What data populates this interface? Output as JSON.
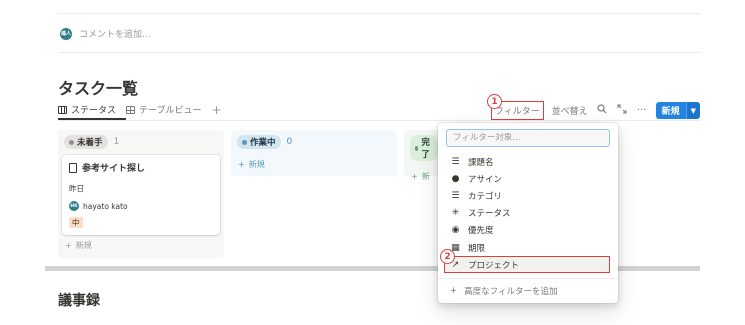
{
  "comment": {
    "avatar": "鳩人",
    "placeholder": "コメントを追加..."
  },
  "page": {
    "title": "タスク一覧",
    "section_title": "議事録"
  },
  "tabs": [
    {
      "label": "ステータス",
      "active": true,
      "icon": "board-icon"
    },
    {
      "label": "テーブルビュー",
      "active": false,
      "icon": "table-icon"
    }
  ],
  "toolbar": {
    "filter_label": "フィルター",
    "sort_label": "並べ替え",
    "new_label": "新規"
  },
  "annotations": {
    "badge1": "1",
    "badge2": "2"
  },
  "board": {
    "columns": [
      {
        "label": "未着手",
        "count": "1",
        "add_label": "新規"
      },
      {
        "label": "作業中",
        "count": "0",
        "add_label": "新規"
      },
      {
        "label": "完了",
        "add_label": "新"
      }
    ],
    "card": {
      "title": "参考サイト探し",
      "date": "昨日",
      "avatar": "HK",
      "assignee": "hayato kato",
      "priority": "中"
    }
  },
  "filter_menu": {
    "search_placeholder": "フィルター対象...",
    "items": [
      {
        "label": "課題名",
        "icon": "list-icon"
      },
      {
        "label": "アサイン",
        "icon": "person-icon"
      },
      {
        "label": "カテゴリ",
        "icon": "list-icon"
      },
      {
        "label": "ステータス",
        "icon": "status-icon"
      },
      {
        "label": "優先度",
        "icon": "target-icon"
      },
      {
        "label": "期限",
        "icon": "calendar-icon"
      },
      {
        "label": "プロジェクト",
        "icon": "relation-icon",
        "highlighted": true
      }
    ],
    "footer_label": "高度なフィルターを追加"
  },
  "colors": {
    "accent": "#2383e2",
    "annotation_red": "#e03e3e"
  }
}
